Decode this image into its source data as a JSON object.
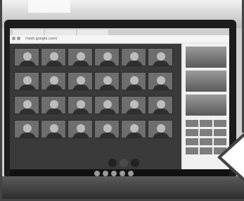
{
  "browser": {
    "tab_labels": [
      "",
      "",
      ""
    ],
    "url": "meet.google.com/"
  },
  "meet": {
    "participant_count_visible": 24,
    "caption_text": "",
    "controls": [
      "mic-icon",
      "hangup-icon",
      "camera-icon"
    ]
  },
  "side_panel": {
    "thumbnails": 3,
    "grid_cells": 12
  },
  "taskbar": {
    "icons": [
      "chrome-icon",
      "files-icon",
      "camera-icon",
      "settings-icon",
      "meet-icon"
    ]
  },
  "colors": {
    "frame": "#0b46d6",
    "screen_bg": "#e9e9e9"
  }
}
